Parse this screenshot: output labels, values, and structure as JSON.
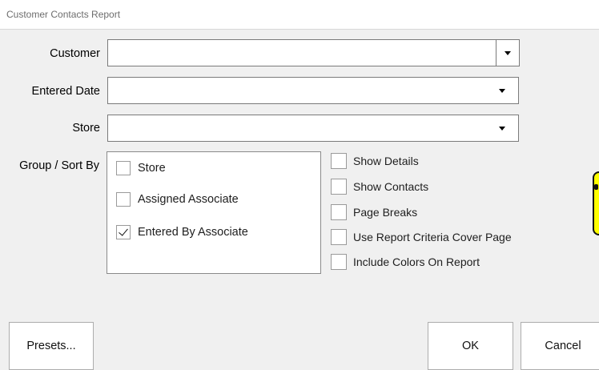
{
  "window": {
    "title": "Customer Contacts Report"
  },
  "fields": {
    "customer": {
      "label": "Customer",
      "value": ""
    },
    "entered_date": {
      "label": "Entered Date",
      "value": ""
    },
    "store": {
      "label": "Store",
      "value": ""
    }
  },
  "group_sort": {
    "label": "Group / Sort By",
    "options": [
      {
        "label": "Store",
        "checked": false
      },
      {
        "label": "Assigned Associate",
        "checked": false
      },
      {
        "label": "Entered By Associate",
        "checked": true
      }
    ]
  },
  "options": [
    {
      "label": "Show Details",
      "checked": false
    },
    {
      "label": "Show Contacts",
      "checked": false
    },
    {
      "label": "Page Breaks",
      "checked": false
    },
    {
      "label": "Use Report Criteria Cover Page",
      "checked": false
    },
    {
      "label": "Include Colors On Report",
      "checked": false
    }
  ],
  "buttons": {
    "presets": "Presets...",
    "ok": "OK",
    "cancel": "Cancel"
  },
  "icons": {
    "dropdown": "chevron-down-icon",
    "check": "check-icon"
  },
  "colors": {
    "badge": "#ffff00"
  }
}
